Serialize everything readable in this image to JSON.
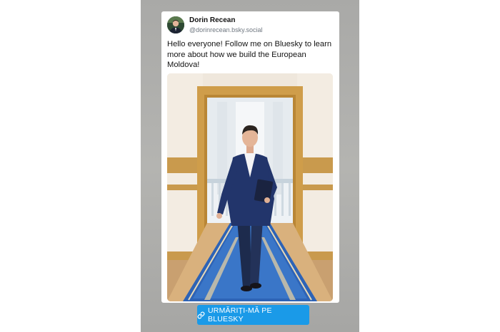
{
  "post": {
    "author_name": "Dorin Recean",
    "author_handle": "@dorinrecean.bsky.social",
    "text": "Hello everyone! Follow me on Bluesky to learn more about how we build the European Moldova!"
  },
  "cta": {
    "label": "URMĂRIȚI-MĂ PE BLUESKY",
    "icon": "link-icon",
    "color": "#1a9ae8"
  },
  "colors": {
    "story_background": "#acacaa",
    "card_background": "#ffffff"
  }
}
